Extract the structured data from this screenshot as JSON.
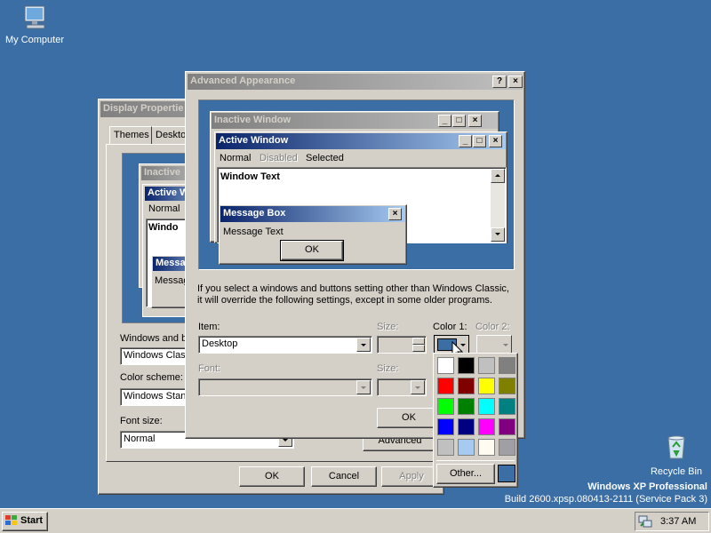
{
  "desktop": {
    "my_computer": "My Computer",
    "recycle_bin": "Recycle Bin",
    "watermark_line1": "Windows XP Professional",
    "watermark_line2": "Build 2600.xpsp.080413-2111 (Service Pack 3)"
  },
  "display_properties": {
    "title": "Display Propertie",
    "tabs": [
      "Themes",
      "Deskto"
    ],
    "preview": {
      "inactive": "Inactive",
      "active": "Active W",
      "normal": "Normal",
      "window": "Windo",
      "message": "Messa",
      "message_text": "Messag"
    },
    "windows_and_label": "Windows and b",
    "windows_style_value": "Windows Classi",
    "color_scheme_label": "Color scheme:",
    "color_scheme_value": "Windows Stan",
    "font_size_label": "Font size:",
    "font_size_value": "Normal",
    "advanced_button": "Advanced",
    "ok_button": "OK",
    "cancel_button": "Cancel",
    "apply_button": "Apply"
  },
  "advanced_appearance": {
    "title": "Advanced Appearance",
    "help_glyph": "?",
    "close_glyph": "×",
    "preview": {
      "inactive_title": "Inactive Window",
      "active_title": "Active Window",
      "menu_normal": "Normal",
      "menu_disabled": "Disabled",
      "menu_selected": "Selected",
      "window_text": "Window Text",
      "msgbox_title": "Message Box",
      "msgbox_text": "Message Text",
      "msgbox_ok": "OK"
    },
    "info_line1": "If you select a windows and buttons setting other than Windows Classic,",
    "info_line2": "it will override the following settings, except in some older programs.",
    "item_label": "Item:",
    "item_value": "Desktop",
    "size_label": "Size:",
    "color1_label": "Color 1:",
    "color2_label": "Color 2:",
    "font_label": "Font:",
    "font_size_label": "Size:",
    "ok_button": "OK"
  },
  "color_picker": {
    "other_button": "Other...",
    "selected_color": "#3a6ea5",
    "swatches": [
      "#ffffff",
      "#000000",
      "#c0c0c0",
      "#808080",
      "#ff0000",
      "#800000",
      "#ffff00",
      "#808000",
      "#00ff00",
      "#008000",
      "#00ffff",
      "#008080",
      "#0000ff",
      "#000080",
      "#ff00ff",
      "#800080",
      "#c0c0c0",
      "#a6caf0",
      "#fffbf0",
      "#a0a0a4"
    ]
  },
  "taskbar": {
    "start_label": "Start",
    "clock": "3:37 AM"
  }
}
